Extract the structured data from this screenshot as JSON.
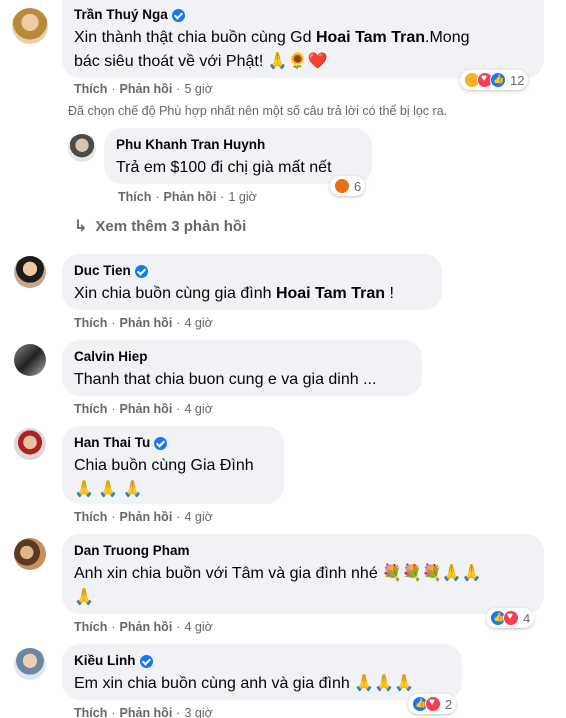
{
  "comments": [
    {
      "author": "Trần Thuý Nga",
      "verified": true,
      "text_parts": [
        "Xin thành thật chia buồn cùng Gd ",
        "Hoai Tam Tran",
        ".Mong"
      ],
      "text_line2": "bác siêu thoát về với Phật! 🙏🌻❤️",
      "like": "Thích",
      "reply": "Phản hồi",
      "time": "5 giờ",
      "reaction_count": "12"
    },
    {
      "author": "Phu Khanh Tran Huynh",
      "verified": false,
      "text": "Trả em $100 đi chị già mất nết",
      "like": "Thích",
      "reply": "Phản hồi",
      "time": "1 giờ",
      "reaction_count": "6"
    },
    {
      "author": "Duc Tien",
      "verified": true,
      "text_parts": [
        "Xin chia buồn cùng gia đình ",
        "Hoai Tam Tran",
        " !"
      ],
      "like": "Thích",
      "reply": "Phản hồi",
      "time": "4 giờ"
    },
    {
      "author": "Calvin Hiep",
      "verified": false,
      "text": "Thanh that chia buon cung e va gia dinh ...",
      "like": "Thích",
      "reply": "Phản hồi",
      "time": "4 giờ"
    },
    {
      "author": "Han Thai Tu",
      "verified": true,
      "text": "Chia buồn cùng Gia Đình",
      "text_line2": "🙏 🙏 🙏",
      "like": "Thích",
      "reply": "Phản hồi",
      "time": "4 giờ"
    },
    {
      "author": "Dan Truong Pham",
      "verified": false,
      "text": "Anh xin chia buồn với Tâm và gia đình nhé 💐💐💐🙏🙏",
      "text_line2": "🙏",
      "like": "Thích",
      "reply": "Phản hồi",
      "time": "4 giờ",
      "reaction_count": "4"
    },
    {
      "author": "Kiều Linh",
      "verified": true,
      "text": "Em xin chia buồn cùng anh và gia đình 🙏🙏🙏",
      "like": "Thích",
      "reply": "Phản hồi",
      "time": "3 giờ",
      "reaction_count": "2"
    }
  ],
  "filter_note": "Đã chọn chế độ Phù hợp nhất nên một số câu trả lời có thể bị lọc ra.",
  "more_replies": "Xem thêm 3 phản hồi",
  "separator": "·",
  "colors": {
    "bubble": "#f0f2f5",
    "meta": "#65676b",
    "like_blue": "#1877f2"
  }
}
